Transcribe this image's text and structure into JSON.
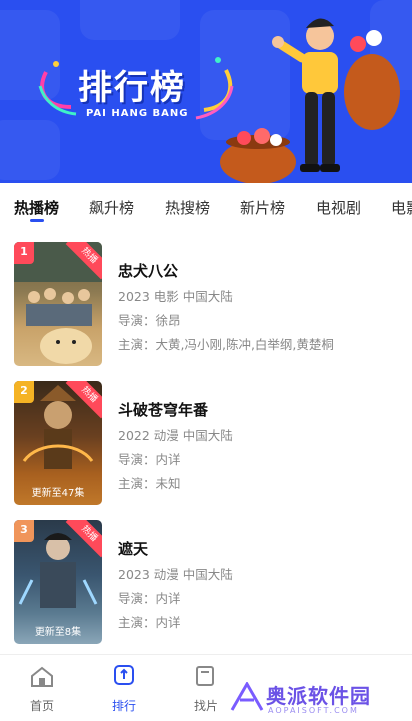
{
  "banner": {
    "title": "排行榜",
    "subtitle": "PAI HANG BANG",
    "bg_color": "#2a4ff0"
  },
  "tabs": [
    {
      "label": "热播榜",
      "active": true
    },
    {
      "label": "飙升榜",
      "active": false
    },
    {
      "label": "热搜榜",
      "active": false
    },
    {
      "label": "新片榜",
      "active": false
    },
    {
      "label": "电视剧",
      "active": false
    },
    {
      "label": "电影",
      "active": false
    }
  ],
  "items": [
    {
      "rank": "1",
      "badge": "热播",
      "title": "忠犬八公",
      "meta": "2023  电影  中国大陆",
      "director": "导演：徐昂",
      "cast": "主演：大黄,冯小刚,陈冲,白举纲,黄楚桐",
      "rank_color": "#ff4a5a"
    },
    {
      "rank": "2",
      "badge": "热播",
      "title": "斗破苍穹年番",
      "meta": "2022  动漫  中国大陆",
      "director": "导演：内详",
      "cast": "主演：未知",
      "rank_color": "#f5b324",
      "poster_text": "更新至47集"
    },
    {
      "rank": "3",
      "badge": "热播",
      "title": "遮天",
      "meta": "2023  动漫  中国大陆",
      "director": "导演：内详",
      "cast": "主演：内详",
      "rank_color": "#f0955a",
      "poster_text": "更新至8集"
    }
  ],
  "bottom_nav": [
    {
      "label": "首页",
      "icon": "home-icon",
      "active": false
    },
    {
      "label": "排行",
      "icon": "ranking-icon",
      "active": true
    },
    {
      "label": "找片",
      "icon": "find-icon",
      "active": false
    }
  ],
  "watermark": {
    "text": "奥派软件园",
    "sub": "AOPAISOFT.COM"
  }
}
